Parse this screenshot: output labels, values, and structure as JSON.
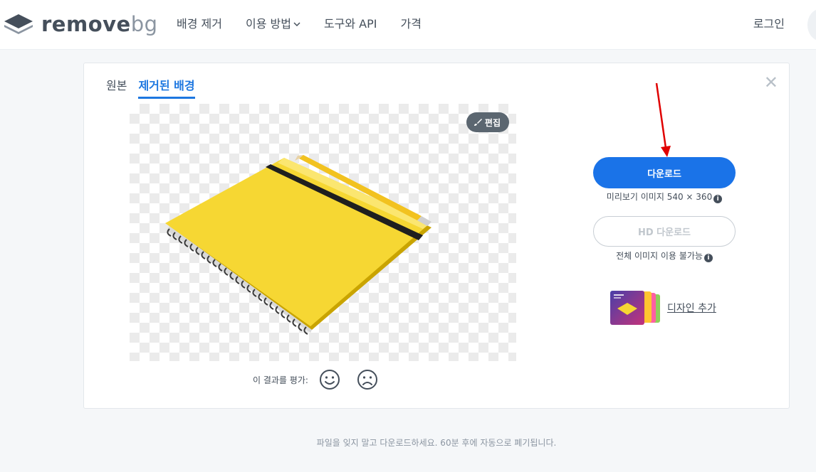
{
  "header": {
    "logo": {
      "word1": "remove",
      "word2": "bg"
    },
    "nav": [
      {
        "label": "배경 제거"
      },
      {
        "label": "이용 방법"
      },
      {
        "label": "도구와 API"
      },
      {
        "label": "가격"
      }
    ],
    "login_label": "로그인"
  },
  "result": {
    "tabs": [
      {
        "label": "원본",
        "active": false
      },
      {
        "label": "제거된 배경",
        "active": true
      }
    ],
    "edit_label": "편집",
    "rating_label": "이 결과를 평가:",
    "download": {
      "button_label": "다운로드",
      "info_text": "미리보기 이미지 540 × 360",
      "accent_color": "#1a73e8"
    },
    "hd_download": {
      "button_label": "HD 다운로드",
      "info_text": "전체 이미지 이용 불가능"
    },
    "add_design_label": "디자인 추가",
    "close_icon": "close-icon"
  },
  "footer": {
    "text": "파일을 잊지 말고 다운로드하세요. 60분 후에 자동으로 폐기됩니다."
  },
  "annotation": {
    "color": "#e00000"
  }
}
